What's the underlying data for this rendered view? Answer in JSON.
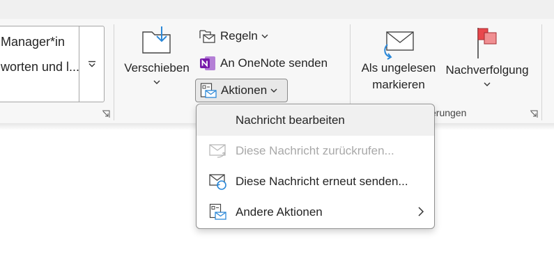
{
  "ribbon": {
    "gallery": {
      "line1": "Manager*in",
      "line2": "worten und l..."
    },
    "move_group": {
      "move_label": "Verschieben",
      "rules_label": "Regeln",
      "onenote_label": "An OneNote senden",
      "actions_label": "Aktionen"
    },
    "tags_group": {
      "unread_line1": "Als ungelesen",
      "unread_line2": "markieren",
      "followup_label": "Nachverfolgung",
      "group_label_partial": "erungen"
    }
  },
  "actions_menu": {
    "items": [
      {
        "label": "Nachricht bearbeiten",
        "icon": "none",
        "state": "highlighted"
      },
      {
        "label": "Diese Nachricht zurückrufen...",
        "icon": "recall-message-icon",
        "state": "disabled"
      },
      {
        "label": "Diese Nachricht erneut senden...",
        "icon": "resend-message-icon",
        "state": "normal"
      },
      {
        "label": "Andere Aktionen",
        "icon": "other-actions-icon",
        "state": "normal",
        "submenu": true
      }
    ]
  },
  "colors": {
    "accent_blue": "#2b88d8",
    "onenote_purple": "#7719aa",
    "flag_red": "#e8474c",
    "ribbon_bg": "#f7f7f7"
  }
}
